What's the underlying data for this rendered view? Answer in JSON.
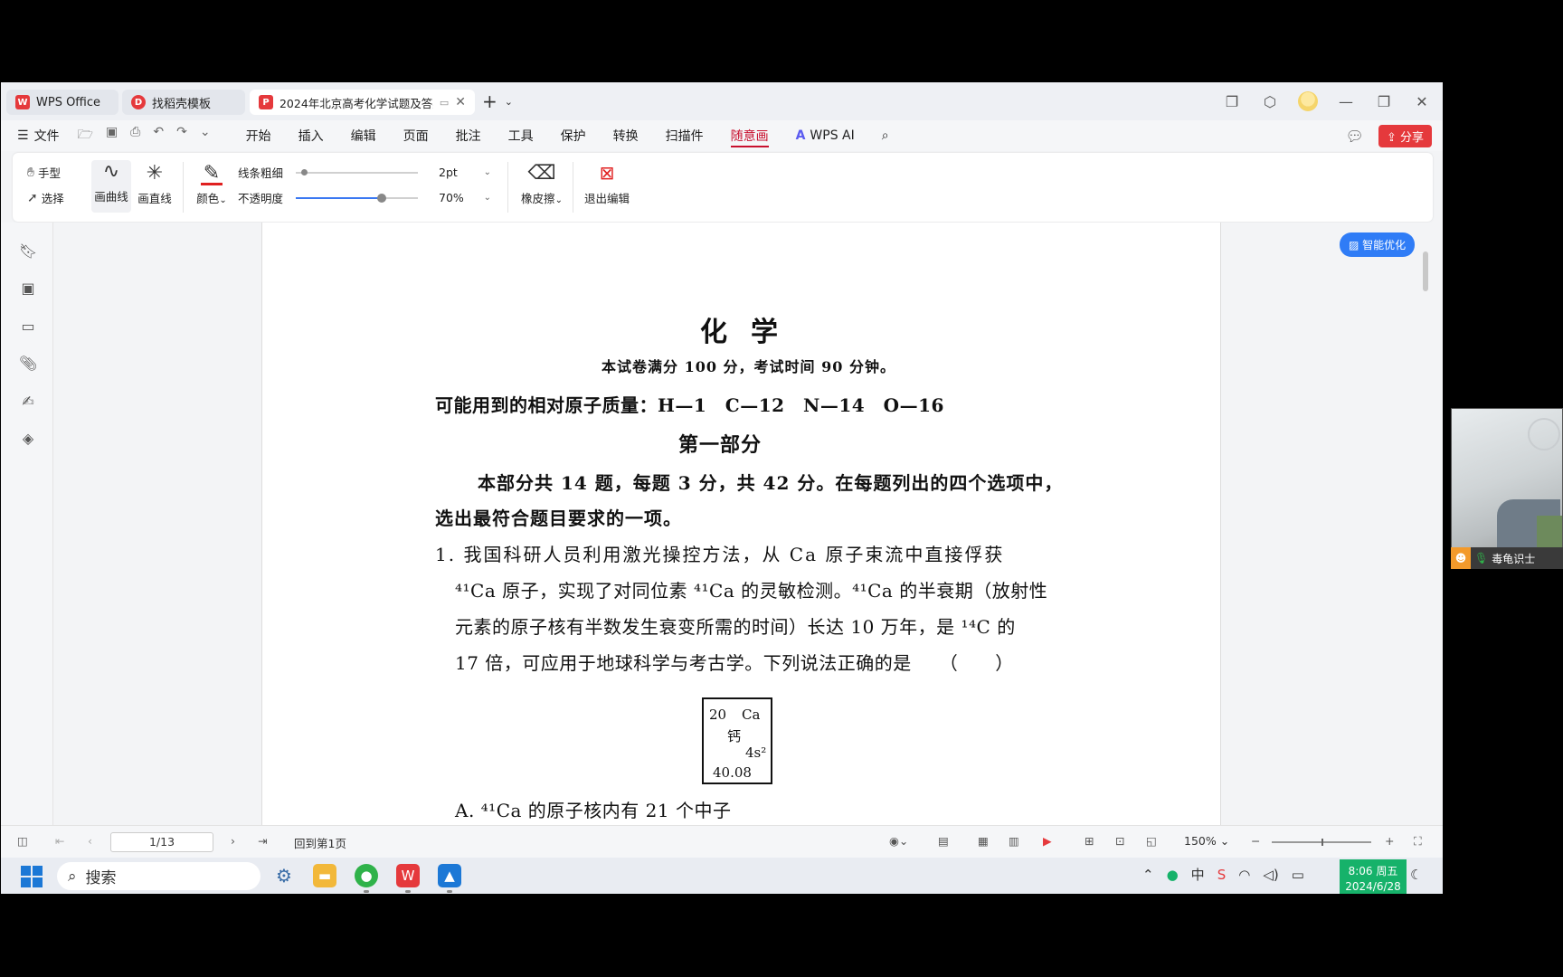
{
  "tabs": {
    "wps": "WPS Office",
    "template": "找稻壳模板",
    "document": "2024年北京高考化学试题及答案"
  },
  "menubar": {
    "file": "文件",
    "items": [
      "开始",
      "插入",
      "编辑",
      "页面",
      "批注",
      "工具",
      "保护",
      "转换",
      "扫描件",
      "随意画"
    ],
    "wps_ai": "WPS AI",
    "share": "分享"
  },
  "ribbon": {
    "hand": "手型",
    "select": "选择",
    "draw_curve": "画曲线",
    "draw_line": "画直线",
    "color": "颜色",
    "line_width_label": "线条粗细",
    "line_width_value": "2pt",
    "opacity_label": "不透明度",
    "opacity_value": "70%",
    "opacity_level": 0.7,
    "eraser": "橡皮擦",
    "exit_edit": "退出编辑"
  },
  "smart_optimize": "智能优化",
  "document": {
    "title": "化学",
    "subtitle": "本试卷满分 100 分，考试时间 90 分钟。",
    "atomic_mass": "可能用到的相对原子质量：H—1　C—12　N—14　O—16",
    "part_title": "第一部分",
    "intro_line1": "本部分共 14 题，每题 3 分，共 42 分。在每题列出的四个选项中，",
    "intro_line2": "选出最符合题目要求的一项。",
    "q1_line1": "1. 我国科研人员利用激光操控方法，从 Ca 原子束流中直接俘获",
    "q1_line2": "⁴¹Ca 原子，实现了对同位素 ⁴¹Ca 的灵敏检测。⁴¹Ca 的半衰期（放射性",
    "q1_line3": "元素的原子核有半数发生衰变所需的时间）长达 10 万年，是 ¹⁴C 的",
    "q1_line4": "17 倍，可应用于地球科学与考古学。下列说法正确的是　　（　　）",
    "element_box": {
      "number": "20",
      "symbol": "Ca",
      "name": "钙",
      "config": "4s²",
      "mass": "40.08"
    },
    "option_a": "A. ⁴¹Ca 的原子核内有 21 个中子"
  },
  "statusbar": {
    "page": "1/13",
    "back_first": "回到第1页",
    "zoom": "150%"
  },
  "taskbar": {
    "search_placeholder": "搜索",
    "time": "8:06 周五",
    "date": "2024/6/28"
  },
  "camera": {
    "user": "毒龟识士"
  }
}
